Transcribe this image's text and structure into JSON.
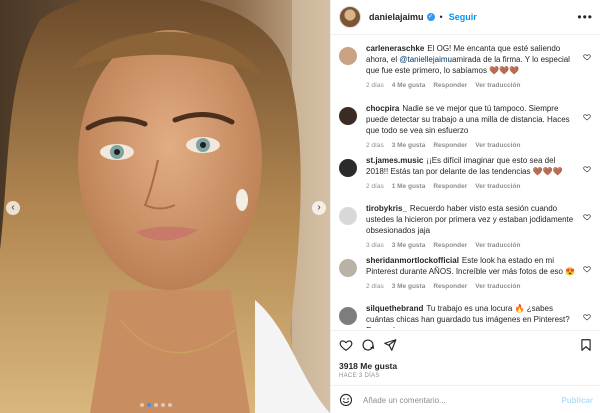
{
  "post": {
    "username": "danielajaimu",
    "follow_label": "Seguir",
    "more_label": "•••"
  },
  "comments": [
    {
      "username": "carleneraschke",
      "text_before": "El OG! Me encanta que esté saliendo ahora, el",
      "mention": "@taniellejaimu",
      "text_after": "amirada de la firma. Y lo especial que fue este primero, lo sabíamos 🤎🤎🤎",
      "time": "2 días",
      "likes": "4 Me gusta",
      "reply": "Responder",
      "translate": "Ver traducción",
      "avatar_color": "#c9a184"
    },
    {
      "username": "chocpira",
      "text": "Nadie se ve mejor que tú tampoco. Siempre puede detectar su trabajo a una milla de distancia. Haces que todo se vea sin esfuerzo",
      "time": "2 días",
      "likes": "3 Me gusta",
      "reply": "Responder",
      "translate": "Ver traducción",
      "avatar_color": "#3a2b24"
    },
    {
      "username": "st.james.music",
      "text": "¡¡Es difícil imaginar que esto sea del 2018!! Estás tan por delante de las tendencias 🤎🤎🤎",
      "time": "2 días",
      "likes": "1 Me gusta",
      "reply": "Responder",
      "translate": "Ver traducción",
      "avatar_color": "#2b2b2b"
    },
    {
      "username": "tirobykris_",
      "text": "Recuerdo haber visto esta sesión cuando ustedes la hicieron por primera vez y estaban jodidamente obsesionados jaja",
      "time": "3 días",
      "likes": "3 Me gusta",
      "reply": "Responder",
      "translate": "Ver traducción",
      "avatar_color": "#d8d8d8"
    },
    {
      "username": "sheridanmortlockofficial",
      "text": "Este look ha estado en mi Pinterest durante AÑOS. Increíble ver más fotos de eso 😍",
      "time": "2 días",
      "likes": "3 Me gusta",
      "reply": "Responder",
      "translate": "Ver traducción",
      "avatar_color": "#b9b2a6"
    },
    {
      "username": "silquethebrand",
      "text": "Tu trabajo es una locura 🔥 ¿sabes cuántas chicas han guardado tus imágenes en Pinterest? Es una locura",
      "time": "",
      "likes": "",
      "reply": "",
      "translate": "",
      "avatar_color": "#7d7d7d"
    }
  ],
  "stats": {
    "likes": "3918 Me gusta",
    "date": "HACE 3 DÍAS"
  },
  "composer": {
    "placeholder": "Añade un comentario...",
    "publish_label": "Publicar"
  },
  "carousel": {
    "prev_icon": "‹",
    "next_icon": "›",
    "slide_count": 5,
    "active_index": 1
  },
  "colors": {
    "accent": "#0095f6",
    "text": "#262626",
    "muted": "#8e8e8e"
  }
}
